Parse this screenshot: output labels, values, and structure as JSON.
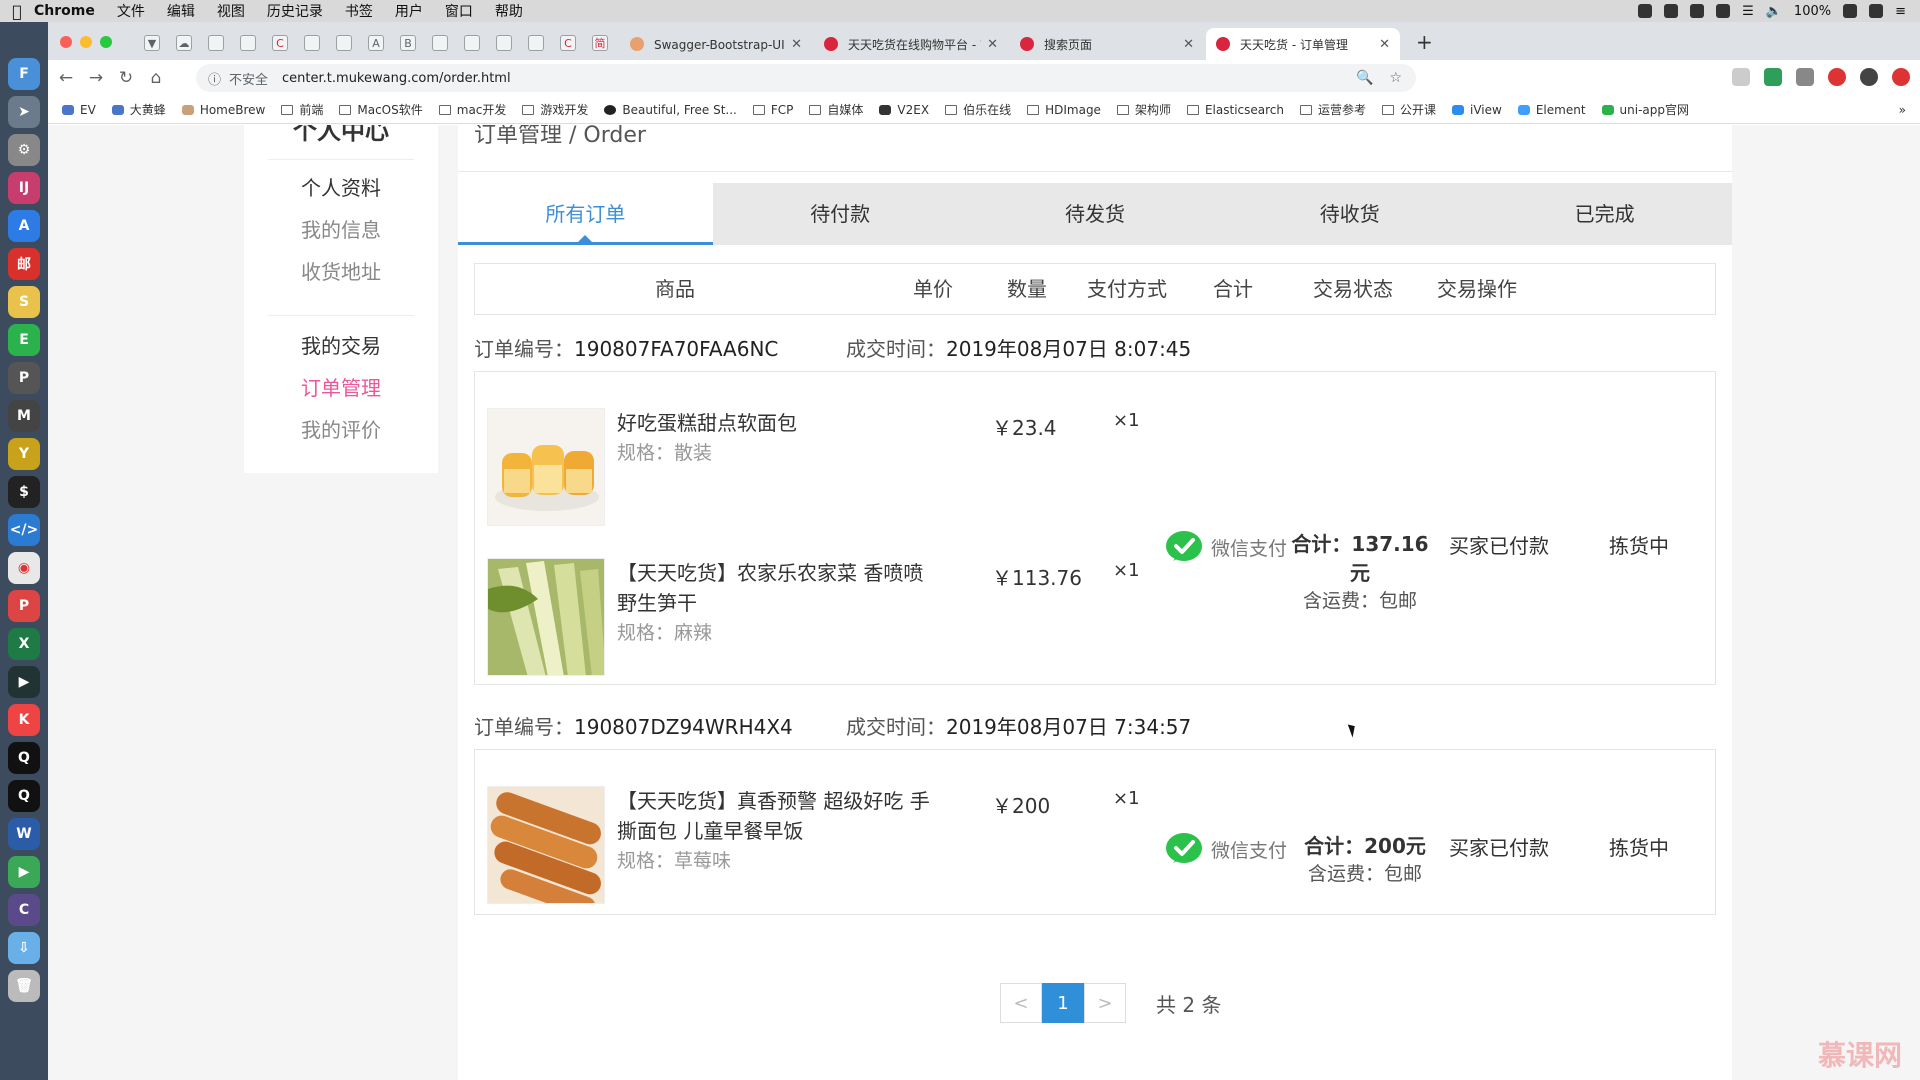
{
  "menubar": {
    "app": "Chrome",
    "items": [
      "文件",
      "编辑",
      "视图",
      "历史记录",
      "书签",
      "用户",
      "窗口",
      "帮助"
    ],
    "battery": "100%"
  },
  "browser": {
    "tabs": [
      {
        "label": "Swagger-Bootstrap-UI-前后端...",
        "favicon_color": "#e8a06e"
      },
      {
        "label": "天天吃货在线购物平台 - 首页",
        "favicon_color": "#d9263e"
      },
      {
        "label": "搜索页面",
        "favicon_color": "#d9263e"
      },
      {
        "label": "天天吃货 - 订单管理",
        "favicon_color": "#d9263e"
      }
    ],
    "insecure_label": "不安全",
    "url": "center.t.mukewang.com/order.html",
    "bookmarks": [
      {
        "label": "EV",
        "icon": "bookmark-favicon"
      },
      {
        "label": "大黄蜂",
        "icon": "bookmark-favicon"
      },
      {
        "label": "HomeBrew",
        "icon": "bookmark-favicon"
      },
      {
        "label": "前端",
        "icon": "folder-icon"
      },
      {
        "label": "MacOS软件",
        "icon": "folder-icon"
      },
      {
        "label": "mac开发",
        "icon": "folder-icon"
      },
      {
        "label": "游戏开发",
        "icon": "folder-icon"
      },
      {
        "label": "Beautiful, Free St...",
        "icon": "bookmark-favicon"
      },
      {
        "label": "FCP",
        "icon": "folder-icon"
      },
      {
        "label": "自媒体",
        "icon": "folder-icon"
      },
      {
        "label": "V2EX",
        "icon": "bookmark-favicon"
      },
      {
        "label": "伯乐在线",
        "icon": "page-icon"
      },
      {
        "label": "HDImage",
        "icon": "folder-icon"
      },
      {
        "label": "架构师",
        "icon": "folder-icon"
      },
      {
        "label": "Elasticsearch",
        "icon": "folder-icon"
      },
      {
        "label": "运营参考",
        "icon": "page-icon"
      },
      {
        "label": "公开课",
        "icon": "folder-icon"
      },
      {
        "label": "iView",
        "icon": "bookmark-favicon"
      },
      {
        "label": "Element",
        "icon": "bookmark-favicon"
      },
      {
        "label": "uni-app官网",
        "icon": "bookmark-favicon"
      }
    ],
    "more": "»"
  },
  "sidebar": {
    "logo": "个人中心",
    "sections": [
      {
        "title": "个人资料",
        "items": [
          "我的信息",
          "收货地址"
        ]
      },
      {
        "title": "我的交易",
        "items": [
          "订单管理",
          "我的评价"
        ]
      }
    ],
    "active_item": "订单管理"
  },
  "main": {
    "breadcrumb": "订单管理 / Order",
    "tabs": [
      "所有订单",
      "待付款",
      "待发货",
      "待收货",
      "已完成"
    ],
    "table_headers": [
      "商品",
      "单价",
      "数量",
      "支付方式",
      "合计",
      "交易状态",
      "交易操作"
    ],
    "orders": [
      {
        "no_label": "订单编号：",
        "no": "190807FA70FAA6NC",
        "time_label": "成交时间：",
        "time": "2019年08月07日 8:07:45",
        "items": [
          {
            "name": "好吃蛋糕甜点软面包",
            "spec": "规格：散装",
            "price": "￥23.4",
            "qty": "×1"
          },
          {
            "name": "【天天吃货】农家乐农家菜 香喷喷野生笋干",
            "spec": "规格：麻辣",
            "price": "￥113.76",
            "qty": "×1"
          }
        ],
        "pay": "微信支付",
        "total": "合计：137.16元",
        "shipping": "含运费：包邮",
        "status": "买家已付款",
        "op": "拣货中"
      },
      {
        "no_label": "订单编号：",
        "no": "190807DZ94WRH4X4",
        "time_label": "成交时间：",
        "time": "2019年08月07日 7:34:57",
        "items": [
          {
            "name": "【天天吃货】真香预警 超级好吃 手撕面包 儿童早餐早饭",
            "spec": "规格：草莓味",
            "price": "￥200",
            "qty": "×1"
          }
        ],
        "pay": "微信支付",
        "total": "合计：200元",
        "shipping": "含运费：包邮",
        "status": "买家已付款",
        "op": "拣货中"
      }
    ],
    "pager": {
      "prev": "<",
      "current": "1",
      "next": ">",
      "total": "共 2 条"
    }
  },
  "watermark": "慕课网",
  "colors": {
    "accent": "#3b8fd9",
    "active_sidebar": "#e8589b",
    "wechat": "#2ac24a"
  }
}
